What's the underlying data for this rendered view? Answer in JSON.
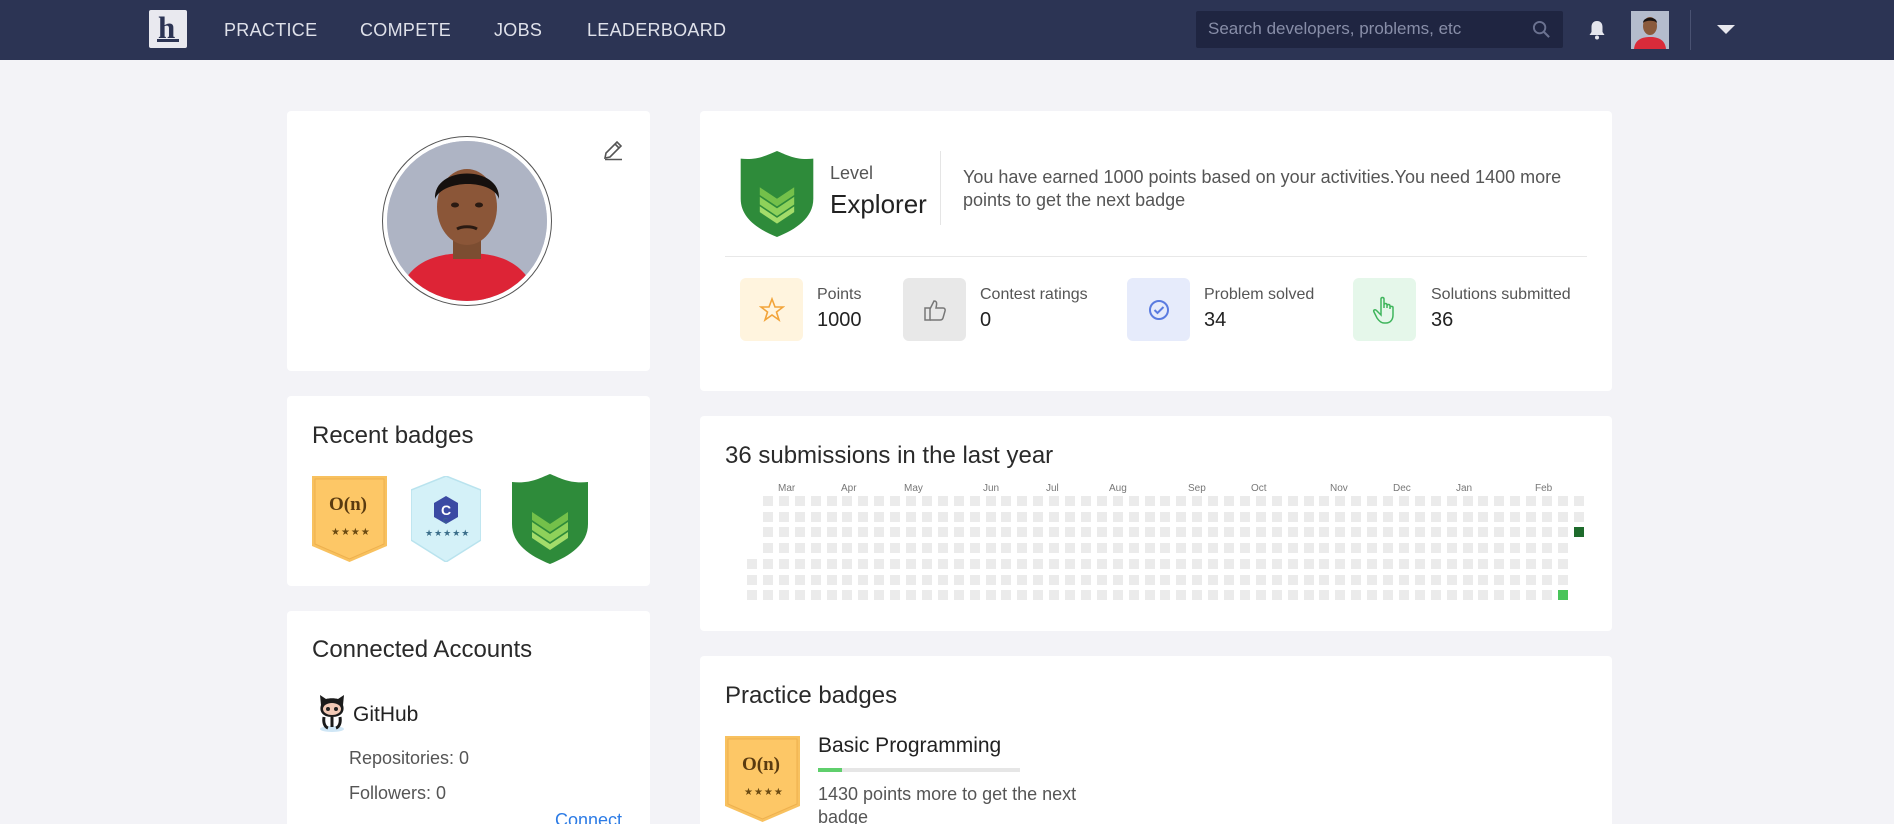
{
  "nav": {
    "links": [
      "PRACTICE",
      "COMPETE",
      "JOBS",
      "LEADERBOARD"
    ],
    "search_placeholder": "Search developers, problems, etc",
    "logo_letter": "h"
  },
  "level": {
    "label": "Level",
    "value": "Explorer",
    "message": "You have earned 1000 points based on your activities.You need 1400 more points to get the next badge"
  },
  "stats": [
    {
      "label": "Points",
      "value": "1000",
      "icon": "star-icon"
    },
    {
      "label": "Contest ratings",
      "value": "0",
      "icon": "thumbs-up-icon"
    },
    {
      "label": "Problem solved",
      "value": "34",
      "icon": "check-circle-icon"
    },
    {
      "label": "Solutions submitted",
      "value": "36",
      "icon": "pointer-hand-icon"
    }
  ],
  "submissions": {
    "title": "36 submissions in the last year",
    "months": [
      "Mar",
      "Apr",
      "May",
      "Jun",
      "Jul",
      "Aug",
      "Sep",
      "Oct",
      "Nov",
      "Dec",
      "Jan",
      "Feb"
    ],
    "active_cells": [
      {
        "week": 52,
        "day": 3,
        "level": "dark"
      },
      {
        "week": 51,
        "day": 7,
        "level": "light"
      }
    ]
  },
  "recent_badges": {
    "title": "Recent badges",
    "items": [
      {
        "name": "big-o-badge",
        "text": "O(n)",
        "stars": "★★★★"
      },
      {
        "name": "c-language-badge",
        "text": "C",
        "sub": "C",
        "stars": "★★★★★"
      },
      {
        "name": "explorer-badge"
      }
    ]
  },
  "accounts": {
    "title": "Connected Accounts",
    "github": {
      "name": "GitHub",
      "repos": "Repositories: 0",
      "followers": "Followers: 0",
      "connect": "Connect"
    }
  },
  "practice_badges": {
    "title": "Practice badges",
    "items": [
      {
        "title": "Basic Programming",
        "desc": "1430 points more to get the next badge",
        "progress": 0.12,
        "badge_text": "O(n)",
        "stars": "★★★★"
      }
    ]
  },
  "colors": {
    "nav_bg": "#2c3454",
    "accent_green": "#2e8b3a",
    "link_blue": "#2c7be5"
  }
}
